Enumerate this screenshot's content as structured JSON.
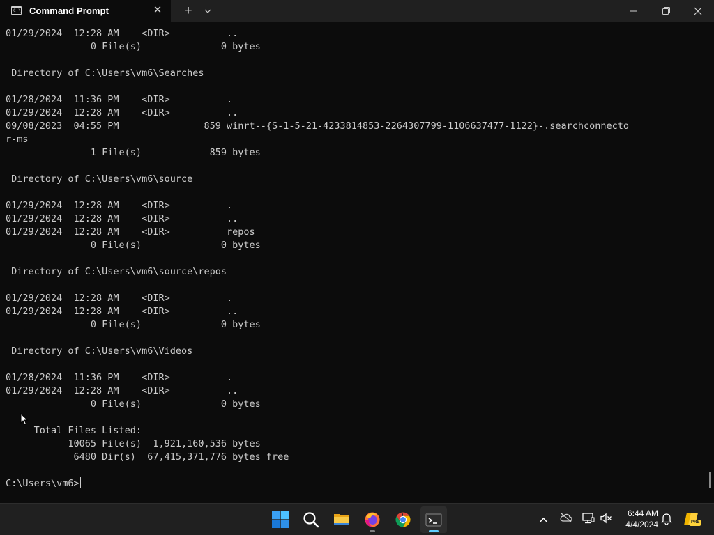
{
  "window": {
    "tab_title": "Command Prompt",
    "tab_icon_text": "C:\\"
  },
  "terminal": {
    "lines": [
      "01/29/2024  12:28 AM    <DIR>          ..",
      "               0 File(s)              0 bytes",
      "",
      " Directory of C:\\Users\\vm6\\Searches",
      "",
      "01/28/2024  11:36 PM    <DIR>          .",
      "01/29/2024  12:28 AM    <DIR>          ..",
      "09/08/2023  04:55 PM               859 winrt--{S-1-5-21-4233814853-2264307799-1106637477-1122}-.searchconnecto",
      "r-ms",
      "               1 File(s)            859 bytes",
      "",
      " Directory of C:\\Users\\vm6\\source",
      "",
      "01/29/2024  12:28 AM    <DIR>          .",
      "01/29/2024  12:28 AM    <DIR>          ..",
      "01/29/2024  12:28 AM    <DIR>          repos",
      "               0 File(s)              0 bytes",
      "",
      " Directory of C:\\Users\\vm6\\source\\repos",
      "",
      "01/29/2024  12:28 AM    <DIR>          .",
      "01/29/2024  12:28 AM    <DIR>          ..",
      "               0 File(s)              0 bytes",
      "",
      " Directory of C:\\Users\\vm6\\Videos",
      "",
      "01/28/2024  11:36 PM    <DIR>          .",
      "01/29/2024  12:28 AM    <DIR>          ..",
      "               0 File(s)              0 bytes",
      "",
      "     Total Files Listed:",
      "           10065 File(s)  1,921,160,536 bytes",
      "            6480 Dir(s)  67,415,371,776 bytes free",
      ""
    ],
    "prompt": "C:\\Users\\vm6>"
  },
  "taskbar": {
    "apps": [
      {
        "name": "start-icon",
        "active": false,
        "running": false
      },
      {
        "name": "search-icon",
        "active": false,
        "running": false
      },
      {
        "name": "file-explorer-icon",
        "active": false,
        "running": false
      },
      {
        "name": "firefox-icon",
        "active": false,
        "running": true
      },
      {
        "name": "chrome-icon",
        "active": false,
        "running": false
      },
      {
        "name": "terminal-icon",
        "active": true,
        "running": true
      }
    ],
    "tray": {
      "time": "6:44 AM",
      "date": "4/4/2024",
      "copilot_badge": "PRE"
    }
  },
  "colors": {
    "terminal_bg": "#0c0c0c",
    "terminal_fg": "#cccccc",
    "titlebar_bg": "#202020",
    "taskbar_bg": "#202020",
    "accent": "#60cdff"
  }
}
